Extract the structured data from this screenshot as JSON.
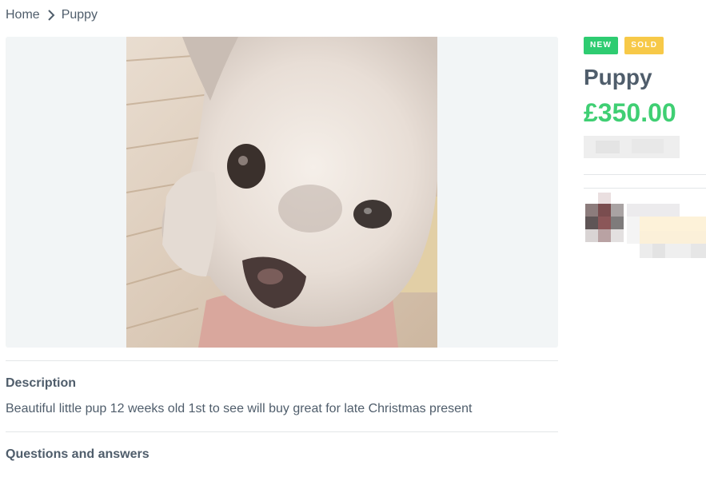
{
  "breadcrumb": {
    "home_label": "Home",
    "separator_icon": "chevron-right-icon",
    "current_label": "Puppy"
  },
  "listing": {
    "badges": {
      "new_label": "NEW",
      "sold_label": "SOLD"
    },
    "title": "Puppy",
    "price": "£350.00",
    "photo_alt": "Puppy"
  },
  "description": {
    "heading": "Description",
    "text": "Beautiful little pup 12 weeks old 1st to see will buy great for late Christmas present"
  },
  "questions": {
    "heading": "Questions and answers"
  },
  "colors": {
    "new_badge": "#2ecc71",
    "sold_badge": "#f7c948",
    "price": "#3fcf73",
    "text": "#4f5d6b"
  }
}
